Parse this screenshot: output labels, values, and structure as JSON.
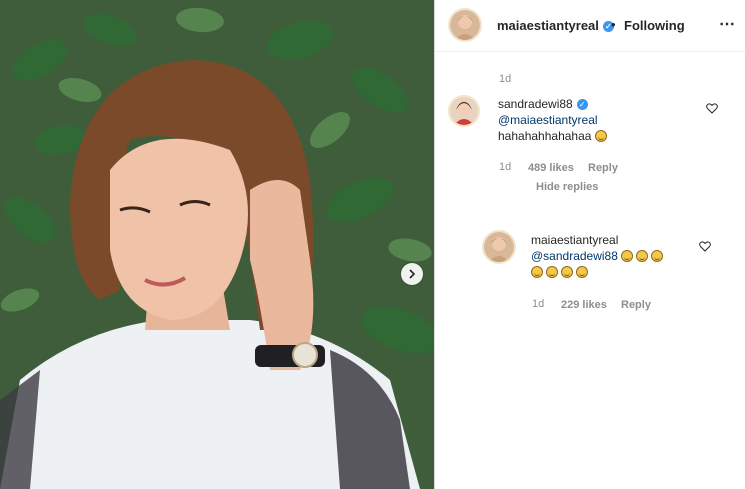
{
  "post": {
    "author": "maiaestiantyreal",
    "separator": "•",
    "follow_status": "Following",
    "more_icon": "⋯",
    "timestamp": "1d"
  },
  "comments": [
    {
      "user": "sandradewi88",
      "verified": true,
      "mention": "@maiaestiantyreal",
      "text": "hahahahhahahaa",
      "time": "1d",
      "likes": "489 likes",
      "reply_label": "Reply",
      "hide_replies_label": "Hide replies"
    },
    {
      "user": "maiaestiantyreal",
      "verified": false,
      "mention": "@sandradewi88",
      "emoji_count": 7,
      "time": "1d",
      "likes": "229 likes",
      "reply_label": "Reply"
    }
  ],
  "icons": {
    "heart": "heart-outline-icon",
    "next": "chevron-right-icon",
    "verified": "verified-badge-icon"
  },
  "colors": {
    "verified_blue": "#3897f0",
    "text": "#262626",
    "muted": "#8e8e8e",
    "mention": "#00376b"
  }
}
